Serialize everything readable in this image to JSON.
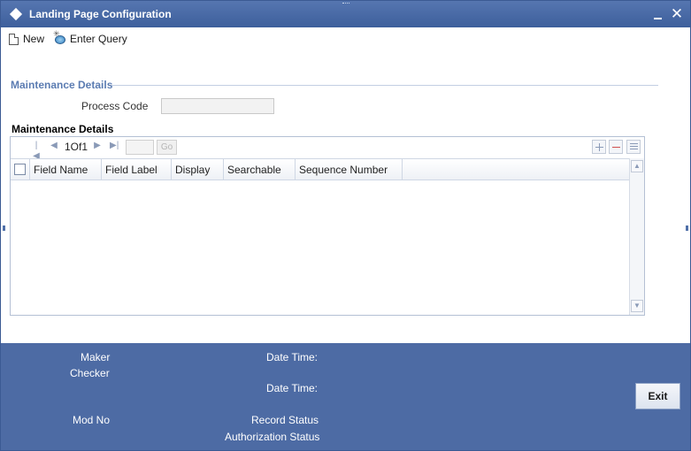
{
  "window": {
    "title": "Landing Page Configuration",
    "minimize_label": "_",
    "close_label": "✕"
  },
  "toolbar": {
    "new_label": "New",
    "enter_query_label": "Enter Query",
    "new_icon": "document-icon",
    "enter_query_icon": "query-icon"
  },
  "maintenance": {
    "group_title": "Maintenance Details",
    "process_code_label": "Process Code",
    "process_code_value": ""
  },
  "grid": {
    "heading": "Maintenance Details",
    "pager_text": "1Of1",
    "page_input_value": "",
    "go_label": "Go",
    "columns": [
      "Field Name",
      "Field Label",
      "Display",
      "Searchable",
      "Sequence Number"
    ],
    "rows": []
  },
  "footer": {
    "maker_label": "Maker",
    "checker_label": "Checker",
    "mod_no_label": "Mod No",
    "date_time_label_1": "Date Time:",
    "date_time_label_2": "Date Time:",
    "record_status_label": "Record Status",
    "authorization_status_label": "Authorization Status",
    "exit_label": "Exit"
  },
  "colors": {
    "titlebar": "#4a6aa6",
    "footer": "#4d6ba4",
    "section_heading": "#5b7cb2"
  }
}
